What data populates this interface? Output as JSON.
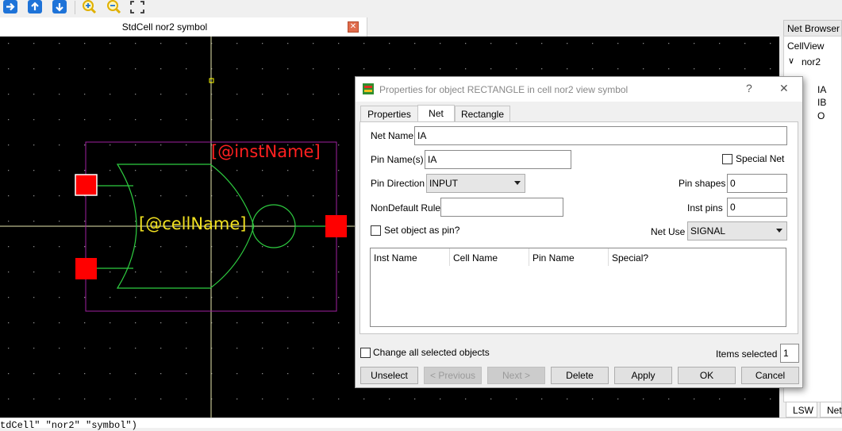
{
  "toolbar": {
    "buttons": [
      {
        "icon": "arrow-right-icon",
        "color": "#1e73d8"
      },
      {
        "icon": "arrow-up-icon",
        "color": "#1e73d8"
      },
      {
        "icon": "arrow-down-icon",
        "color": "#1e73d8"
      },
      {
        "icon": "zoom-in-icon",
        "color": "#e0b000"
      },
      {
        "icon": "zoom-out-icon",
        "color": "#e0b000"
      },
      {
        "icon": "fit-view-icon",
        "color": "#333333"
      }
    ]
  },
  "editor_tab": {
    "title": "StdCell nor2 symbol",
    "close_label": "✕"
  },
  "canvas": {
    "background": "#000000",
    "inst_name_label": "[@instName]",
    "cell_name_label": "[@cellName]",
    "colors": {
      "bbox": "#a020a0",
      "gate": "#2ecc40",
      "pin": "#ff0000",
      "inst": "#ff2020",
      "cell": "#f0e020",
      "axis": "#e8e8b0"
    }
  },
  "right_panel": {
    "tab": "Net Browser",
    "cellview_label": "CellView",
    "cell": "nor2",
    "nets": [
      "IA",
      "IB",
      "O"
    ],
    "bottom_tabs": [
      "LSW",
      "Net"
    ]
  },
  "console": {
    "text": "tdCell\" \"nor2\" \"symbol\")"
  },
  "dialog": {
    "title": "Properties for object RECTANGLE in cell nor2 view symbol",
    "help_label": "?",
    "close_label": "✕",
    "tabs": [
      "Properties",
      "Net",
      "Rectangle"
    ],
    "active_tab": "Net",
    "fields": {
      "net_name_label": "Net Name",
      "net_name_value": "IA",
      "pin_names_label": "Pin Name(s)",
      "pin_names_value": "IA",
      "special_net_label": "Special Net",
      "pin_direction_label": "Pin Direction",
      "pin_direction_value": "INPUT",
      "pin_shapes_label": "Pin shapes",
      "pin_shapes_value": "0",
      "nondefault_rule_label": "NonDefault Rule",
      "nondefault_rule_value": "",
      "inst_pins_label": "Inst pins",
      "inst_pins_value": "0",
      "set_pin_label": "Set object as pin?",
      "net_use_label": "Net Use",
      "net_use_value": "SIGNAL"
    },
    "table_columns": [
      "Inst Name",
      "Cell Name",
      "Pin Name",
      "Special?"
    ],
    "change_all_label": "Change all selected objects",
    "items_selected_label": "Items selected",
    "items_selected_value": "1",
    "buttons": {
      "unselect": "Unselect",
      "previous": "< Previous",
      "next": "Next >",
      "delete": "Delete",
      "apply": "Apply",
      "ok": "OK",
      "cancel": "Cancel"
    }
  }
}
